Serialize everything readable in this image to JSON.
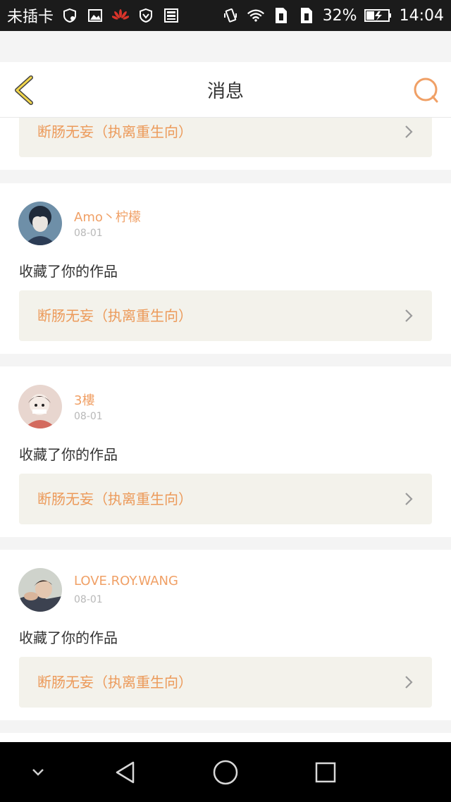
{
  "status_bar": {
    "carrier": "未插卡",
    "battery_percent": "32%",
    "time": "14:04",
    "icons_left": [
      "vpn-shield-icon",
      "image-icon",
      "huawei-logo-icon",
      "shield-icon",
      "sim-manager-icon"
    ],
    "icons_right": [
      "vibrate-icon",
      "wifi-icon",
      "sim1-icon",
      "sim2-icon",
      "battery-charging-icon"
    ]
  },
  "header": {
    "title": "消息",
    "back_icon": "chevron-left-icon",
    "right_icon": "chat-bubble-icon",
    "accent_color": "#f0a066"
  },
  "first_partial_card": {
    "work_title": "断肠无妄（执离重生向）"
  },
  "messages": [
    {
      "username": "Amo丶柠檬",
      "date": "08-01",
      "action": "收藏了你的作品",
      "work_title": "断肠无妄（执离重生向）"
    },
    {
      "username": "3樓",
      "date": "08-01",
      "action": "收藏了你的作品",
      "work_title": "断肠无妄（执离重生向）"
    },
    {
      "username": "LOVE.ROY.WANG",
      "date": "08-01",
      "action": "收藏了你的作品",
      "work_title": "断肠无妄（执离重生向）"
    }
  ],
  "nav_bar": {
    "icons": [
      "collapse-chevron-icon",
      "back-triangle-icon",
      "home-circle-icon",
      "recents-square-icon"
    ]
  }
}
